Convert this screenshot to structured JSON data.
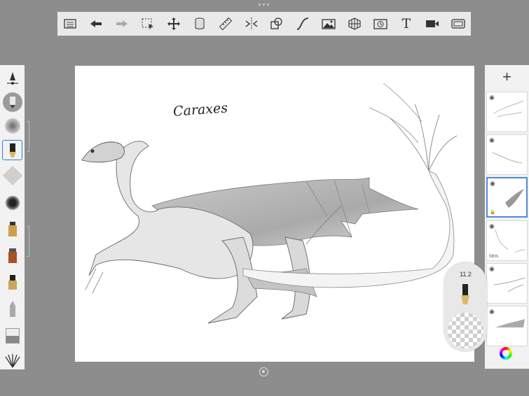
{
  "toolbar": {
    "tools": [
      {
        "name": "layer-list-icon"
      },
      {
        "name": "undo-icon"
      },
      {
        "name": "redo-icon"
      },
      {
        "name": "selection-icon"
      },
      {
        "name": "transform-icon"
      },
      {
        "name": "fill-icon"
      },
      {
        "name": "ruler-icon"
      },
      {
        "name": "symmetry-icon"
      },
      {
        "name": "shapes-icon"
      },
      {
        "name": "curve-icon"
      },
      {
        "name": "image-import-icon"
      },
      {
        "name": "perspective-grid-icon"
      },
      {
        "name": "time-lapse-icon"
      },
      {
        "name": "text-icon"
      },
      {
        "name": "video-record-icon"
      },
      {
        "name": "fullscreen-icon"
      }
    ],
    "text_tool_glyph": "T"
  },
  "canvas": {
    "handwritten_title": "Caraxes"
  },
  "brush_library": {
    "brushes": [
      "pencil-brush",
      "airbrush",
      "ink-pen-brush",
      "chalk-brush",
      "splatter-brush",
      "marker-brush",
      "paint-brush",
      "felt-pen-brush",
      "blender-brush",
      "eraser-brush",
      "fan-brush"
    ],
    "active_index": 3
  },
  "layers": {
    "add_label": "+",
    "items": [
      {
        "name": "layer-1",
        "visible": true,
        "opacity_label": ""
      },
      {
        "name": "layer-2",
        "visible": true,
        "opacity_label": ""
      },
      {
        "name": "layer-3",
        "visible": true,
        "opacity_label": "",
        "active": true
      },
      {
        "name": "layer-4",
        "visible": true,
        "opacity_label": "56%"
      },
      {
        "name": "layer-5",
        "visible": true,
        "opacity_label": ""
      },
      {
        "name": "layer-6",
        "visible": true,
        "opacity_label": ""
      }
    ]
  },
  "brush_puck": {
    "size_value": "11.2"
  },
  "colors": {
    "background": "#8d8d8d",
    "toolbar": "#e9e9e9",
    "accent": "#2f7bd5"
  }
}
